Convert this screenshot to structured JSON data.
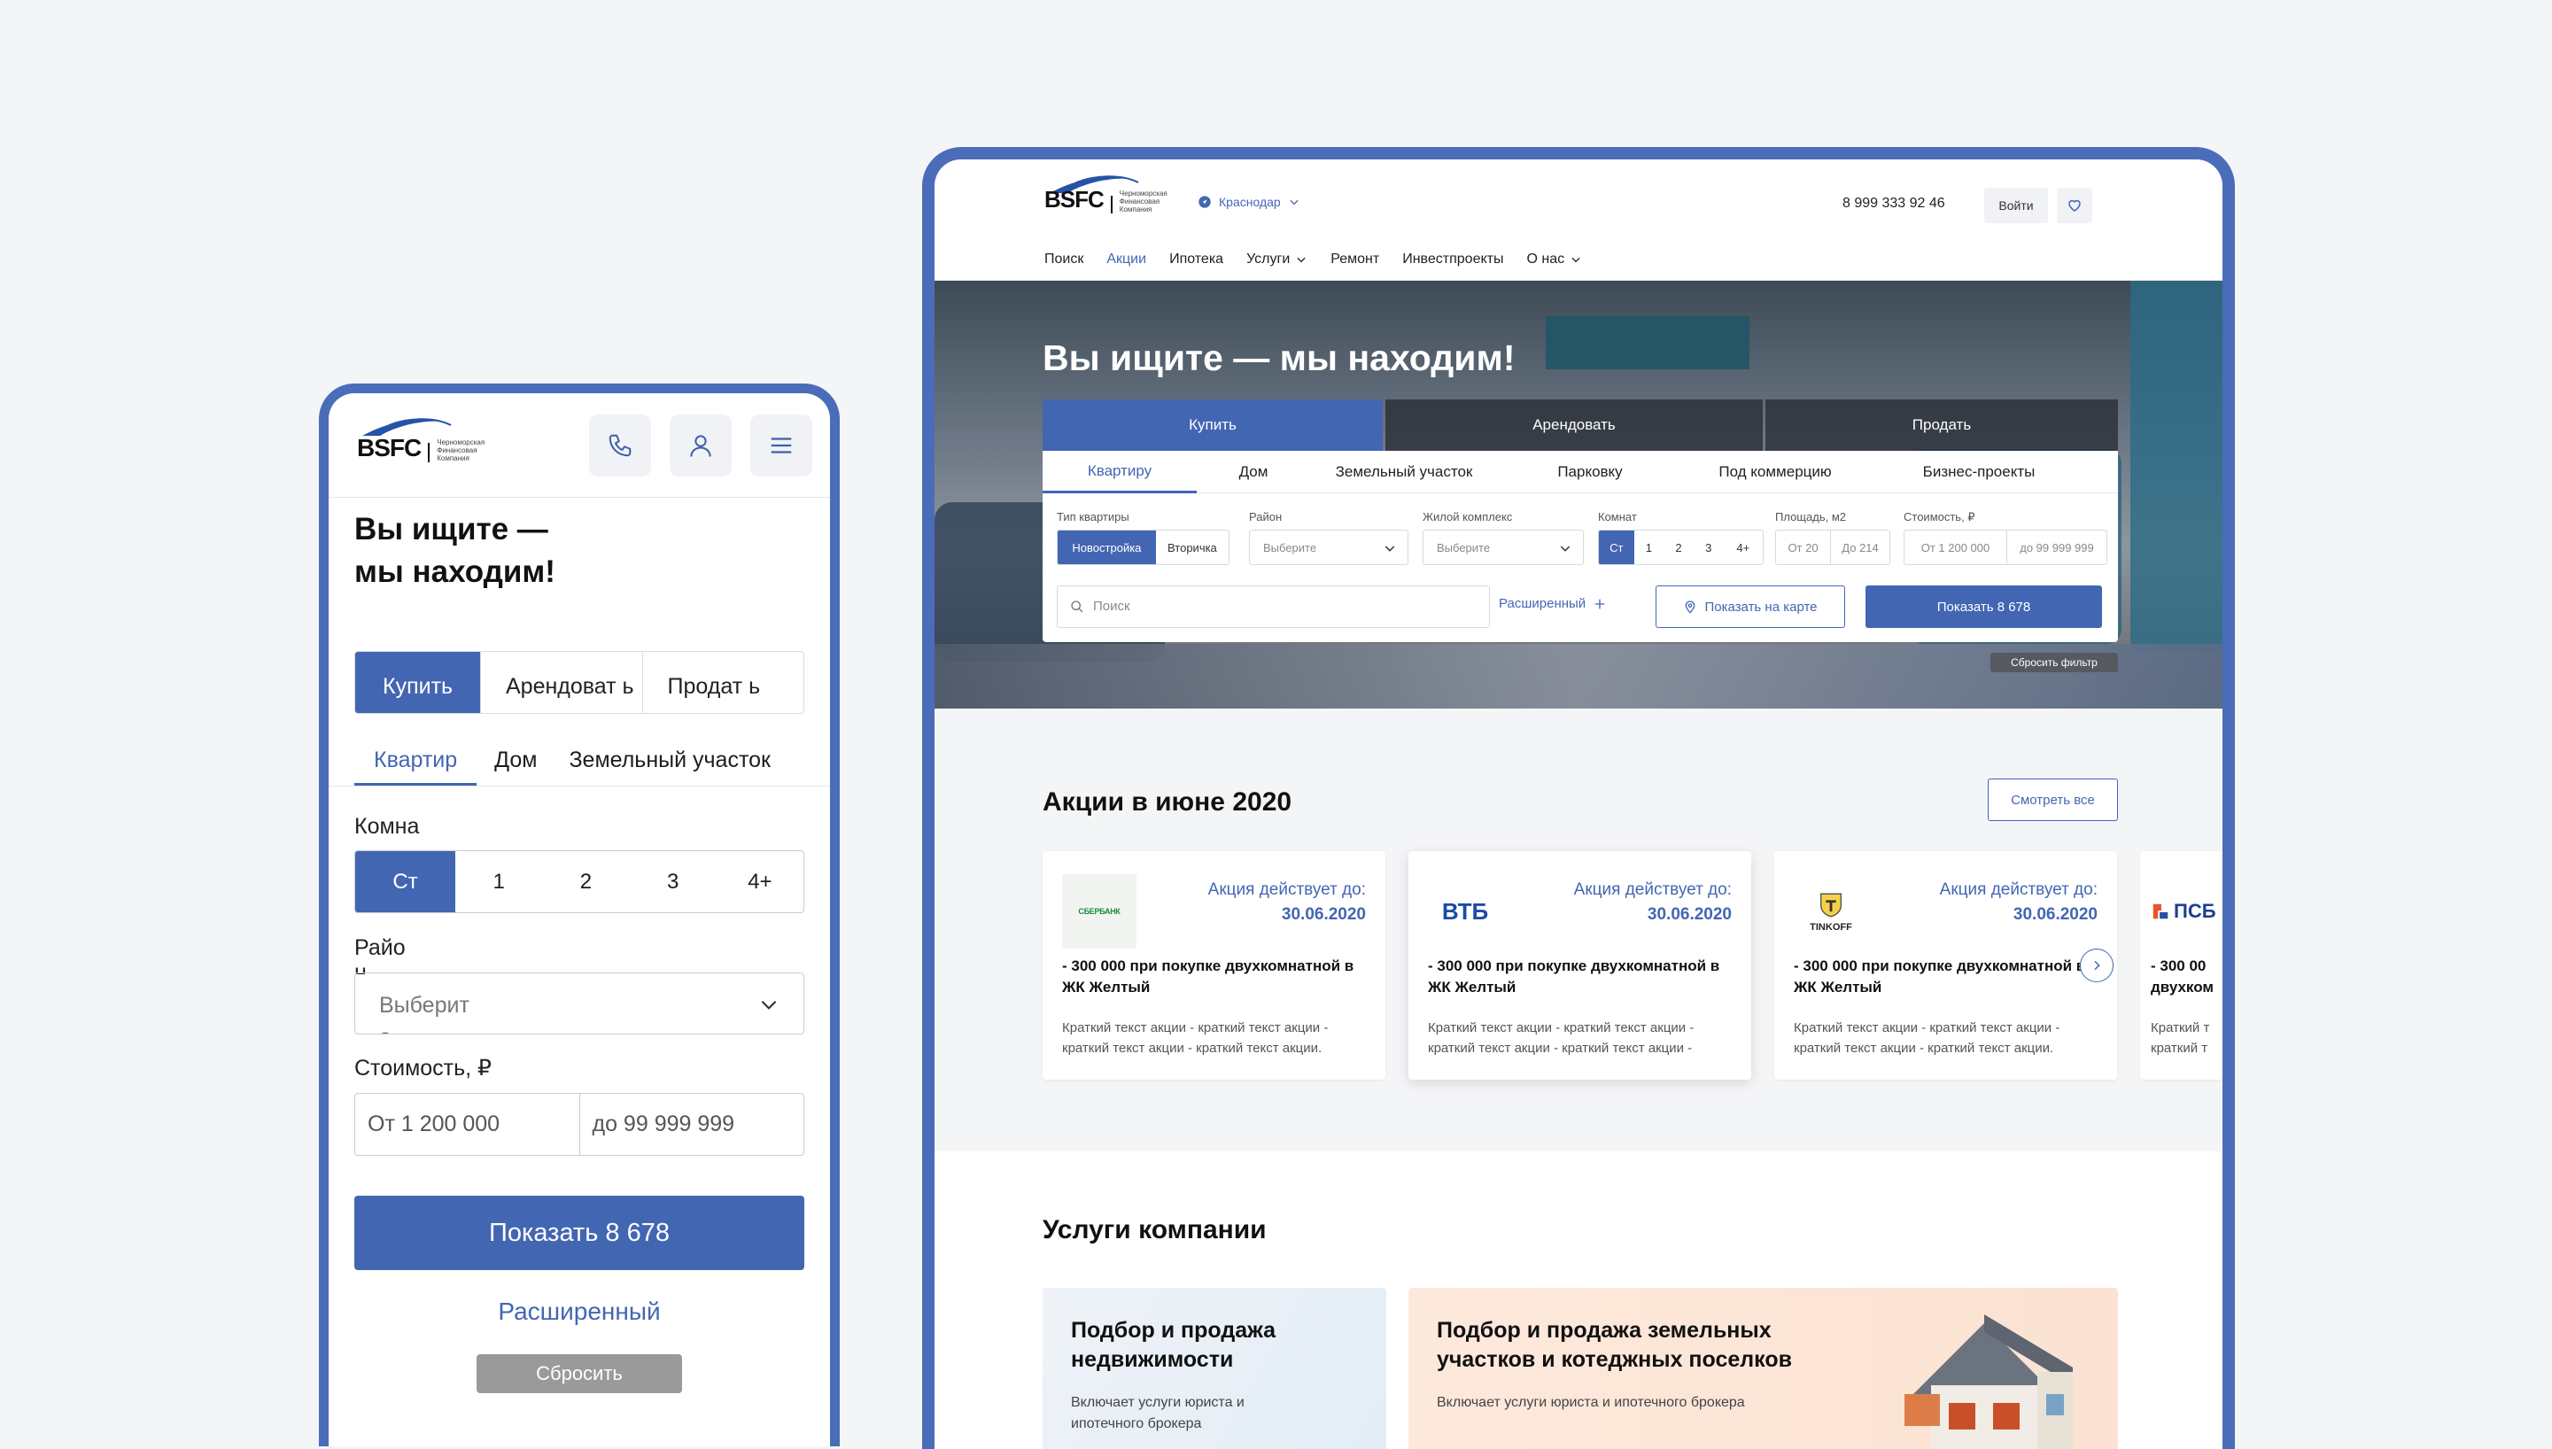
{
  "brand": {
    "logo_mark": "BSFC",
    "logo_sub": [
      "Черноморская",
      "Финансовая",
      "Компания"
    ]
  },
  "colors": {
    "accent": "#4366b3",
    "frame": "#4a6cb9",
    "background": "#f4f5f7"
  },
  "mobile": {
    "icons": [
      "phone-icon",
      "user-icon",
      "menu-icon"
    ],
    "hero_title_line1": "Вы ищите —",
    "hero_title_line2": "мы находим!",
    "deal_tabs": [
      "Купить",
      "Арендоват ь",
      "Продат ь"
    ],
    "property_tabs": [
      "Квартир",
      "Дом",
      "Земельный участок"
    ],
    "rooms_label": "Комна",
    "rooms": [
      "Ст",
      "1",
      "2",
      "3",
      "4+"
    ],
    "district_label": "Райо н",
    "district_placeholder": "Выберит е",
    "price_label": "Стоимость, ₽",
    "price_from": "От 1 200 000",
    "price_to": "до 99 999 999",
    "show_button": "Показать  8 678",
    "advanced_link": "Расширенный",
    "reset_button": "Сбросить"
  },
  "desktop": {
    "city": "Краснодар",
    "phone": "8 999 333 92 46",
    "login_button": "Войти",
    "nav": [
      {
        "label": "Поиск"
      },
      {
        "label": "Акции",
        "active": true
      },
      {
        "label": "Ипотека"
      },
      {
        "label": "Услуги",
        "dropdown": true
      },
      {
        "label": "Ремонт"
      },
      {
        "label": "Инвестпроекты"
      },
      {
        "label": "О нас",
        "dropdown": true
      }
    ],
    "hero_title": "Вы ищите — мы находим!",
    "deal_tabs": [
      "Купить",
      "Арендовать",
      "Продать"
    ],
    "property_tabs": [
      "Квартиру",
      "Дом",
      "Земельный участок",
      "Парковку",
      "Под коммерцию",
      "Бизнес-проекты"
    ],
    "filters": {
      "apt_type_label": "Тип квартиры",
      "apt_types": [
        "Новостройка",
        "Вторичка"
      ],
      "district_label": "Район",
      "district_placeholder": "Выберите",
      "complex_label": "Жилой комплекс",
      "complex_placeholder": "Выберите",
      "rooms_label": "Комнат",
      "rooms": [
        "Ст",
        "1",
        "2",
        "3",
        "4+"
      ],
      "area_label": "Площадь, м2",
      "area_from": "От 20",
      "area_to": "До 214",
      "price_label": "Стоимость, ₽",
      "price_from": "От 1 200 000",
      "price_to": "до 99 999 999"
    },
    "search_placeholder": "Поиск",
    "advanced_link": "Расширенный",
    "map_button": "Показать на карте",
    "show_button": "Показать  8 678",
    "reset_filter": "Сбросить фильтр",
    "promos_title": "Акции в июне 2020",
    "see_all": "Смотреть все",
    "promos": [
      {
        "bank": "СБЕРБАНК",
        "until_label": "Акция действует до:",
        "until_date": "30.06.2020",
        "title": "- 300 000 при покупке двухкомнатной в ЖК Желтый",
        "text": "Краткий текст акции - краткий текст акции - краткий текст акции - краткий текст акции."
      },
      {
        "bank": "ВТБ",
        "until_label": "Акция действует до:",
        "until_date": "30.06.2020",
        "title": "- 300 000 при покупке двухкомнатной в ЖК Желтый",
        "text": "Краткий текст акции - краткий текст акции - краткий текст акции - краткий текст акции -"
      },
      {
        "bank": "TINKOFF",
        "until_label": "Акция действует до:",
        "until_date": "30.06.2020",
        "title": "- 300 000 при покупке двухкомнатной в ЖК Желтый",
        "text": "Краткий текст акции - краткий текст акции - краткий текст акции - краткий текст акции."
      },
      {
        "bank": "ПСБ",
        "until_label": "",
        "until_date": "",
        "title": "- 300 00 двухком",
        "text": "Краткий т краткий т"
      }
    ],
    "services_title": "Услуги компании",
    "services": [
      {
        "title": "Подбор и продажа недвижимости",
        "text": "Включает услуги юриста и ипотечного брокера"
      },
      {
        "title": "Подбор и продажа земельных участков и котеджных поселков",
        "text": "Включает услуги юриста и ипотечного брокера"
      }
    ]
  }
}
